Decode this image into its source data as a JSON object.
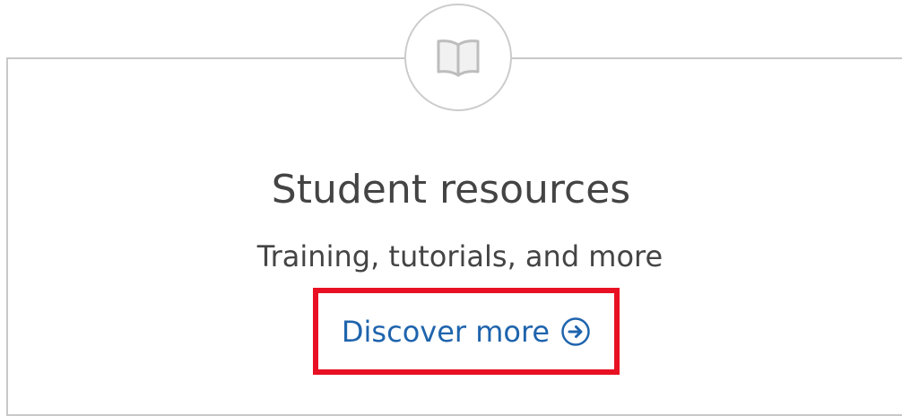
{
  "card": {
    "icon": "open-book-icon",
    "title": "Student resources",
    "subtitle": "Training, tutorials, and more",
    "cta": {
      "label": "Discover more",
      "icon": "arrow-right-circle-icon",
      "highlight": "highlighted"
    }
  },
  "colors": {
    "card_border": "#c8c8c8",
    "text": "#444444",
    "link": "#1f64ad",
    "highlight_border": "#e81123",
    "icon_gray": "#bdbdbd"
  }
}
